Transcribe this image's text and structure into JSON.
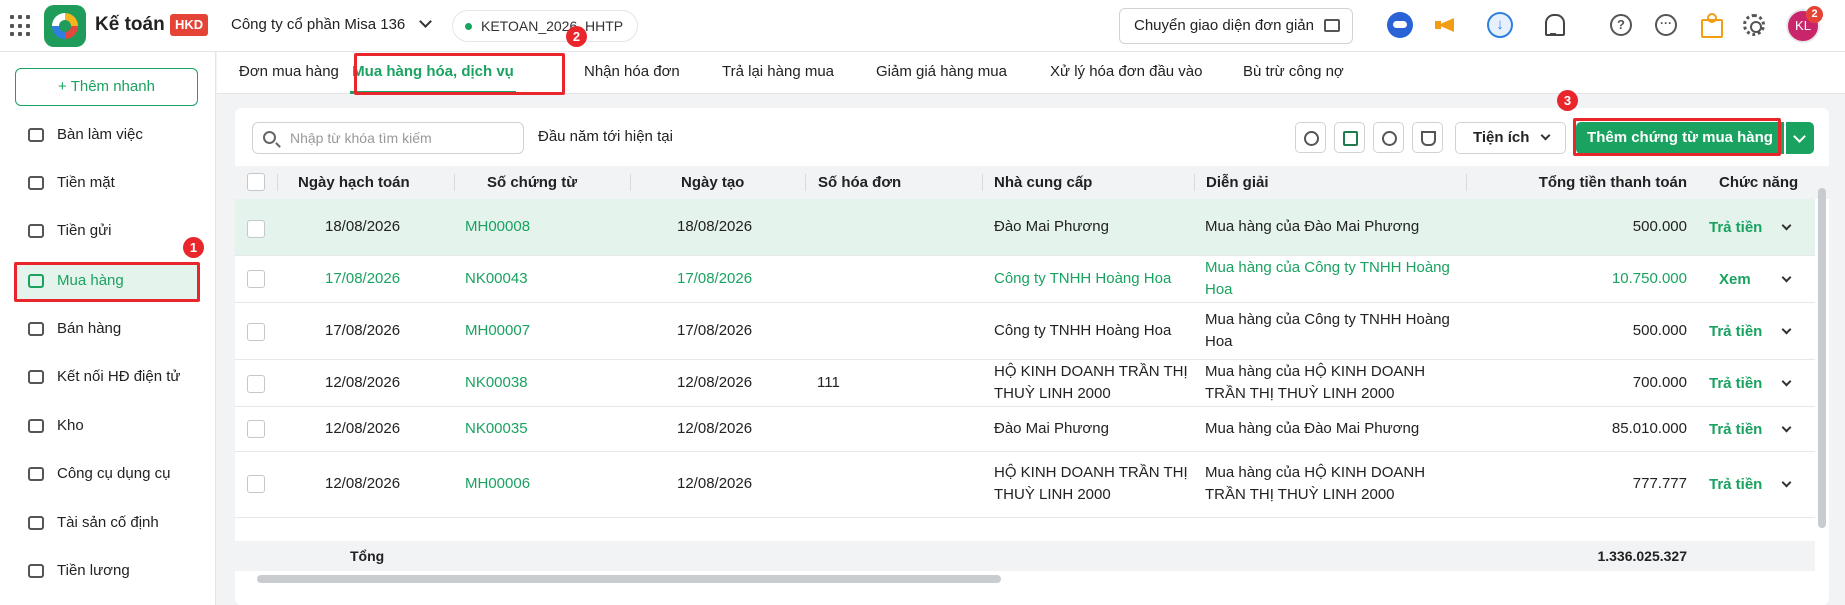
{
  "app": {
    "name": "Kế toán",
    "badge": "HKD"
  },
  "header": {
    "company": "Công ty cổ phần Misa 136",
    "database": "KETOAN_2026_HHTP",
    "switch_ui_label": "Chuyển giao diện đơn giản",
    "avatar_initials": "KL",
    "notification_count": "2"
  },
  "sidebar": {
    "quick_add": "+ Thêm nhanh",
    "items": [
      {
        "label": "Bàn làm việc",
        "icon": "dashboard-icon"
      },
      {
        "label": "Tiền mặt",
        "icon": "cash-icon"
      },
      {
        "label": "Tiền gửi",
        "icon": "bank-icon"
      },
      {
        "label": "Mua hàng",
        "icon": "cart-icon"
      },
      {
        "label": "Bán hàng",
        "icon": "tag-icon"
      },
      {
        "label": "Kết nối HĐ điện tử",
        "icon": "invoice-icon"
      },
      {
        "label": "Kho",
        "icon": "box-icon"
      },
      {
        "label": "Công cụ dụng cụ",
        "icon": "tools-icon"
      },
      {
        "label": "Tài sản cố định",
        "icon": "truck-icon"
      },
      {
        "label": "Tiền lương",
        "icon": "salary-icon"
      }
    ]
  },
  "annotations": {
    "step1": "1",
    "step2": "2",
    "step3": "3"
  },
  "tabs": [
    "Đơn mua hàng",
    "Mua hàng hóa, dịch vụ",
    "Nhận hóa đơn",
    "Trả lại hàng mua",
    "Giảm giá hàng mua",
    "Xử lý hóa đơn đầu vào",
    "Bù trừ công nợ"
  ],
  "toolbar": {
    "search_placeholder": "Nhập từ khóa tìm kiếm",
    "period": "Đầu năm tới hiện tại",
    "utilities": "Tiện ích",
    "add_voucher": "Thêm chứng từ mua hàng"
  },
  "table": {
    "columns": [
      "Ngày hạch toán",
      "Số chứng từ",
      "Ngày tạo",
      "Số hóa đơn",
      "Nhà cung cấp",
      "Diễn giải",
      "Tổng tiền thanh toán",
      "Chức năng"
    ],
    "rows": [
      {
        "posting_date": "18/08/2026",
        "voucher_no": "MH00008",
        "created_date": "18/08/2026",
        "invoice_no": "",
        "supplier": [
          "Đào Mai Phương"
        ],
        "description": [
          "Mua hàng của Đào Mai Phương"
        ],
        "total": "500.000",
        "action": "Trả tiền"
      },
      {
        "posting_date": "17/08/2026",
        "voucher_no": "NK00043",
        "created_date": "17/08/2026",
        "invoice_no": "",
        "supplier": [
          "Công ty TNHH Hoàng Hoa"
        ],
        "description": [
          "Mua hàng của Công ty TNHH Hoàng",
          "Hoa"
        ],
        "total": "10.750.000",
        "action": "Xem"
      },
      {
        "posting_date": "17/08/2026",
        "voucher_no": "MH00007",
        "created_date": "17/08/2026",
        "invoice_no": "",
        "supplier": [
          "Công ty TNHH Hoàng Hoa"
        ],
        "description": [
          "Mua hàng của Công ty TNHH Hoàng",
          "Hoa"
        ],
        "total": "500.000",
        "action": "Trả tiền"
      },
      {
        "posting_date": "12/08/2026",
        "voucher_no": "NK00038",
        "created_date": "12/08/2026",
        "invoice_no": "111",
        "supplier": [
          "HỘ KINH DOANH TRẦN THỊ",
          "THUỲ LINH 2000"
        ],
        "description": [
          "Mua hàng của HỘ KINH DOANH",
          "TRẦN THỊ THUỲ LINH 2000"
        ],
        "total": "700.000",
        "action": "Trả tiền"
      },
      {
        "posting_date": "12/08/2026",
        "voucher_no": "NK00035",
        "created_date": "12/08/2026",
        "invoice_no": "",
        "supplier": [
          "Đào Mai Phương"
        ],
        "description": [
          "Mua hàng của Đào Mai Phương"
        ],
        "total": "85.010.000",
        "action": "Trả tiền"
      },
      {
        "posting_date": "12/08/2026",
        "voucher_no": "MH00006",
        "created_date": "12/08/2026",
        "invoice_no": "",
        "supplier": [
          "HỘ KINH DOANH TRẦN THỊ",
          "THUỲ LINH 2000"
        ],
        "description": [
          "Mua hàng của HỘ KINH DOANH",
          "TRẦN THỊ THUỲ LINH 2000"
        ],
        "total": "777.777",
        "action": "Trả tiền"
      }
    ],
    "total_label": "Tổng",
    "total_value": "1.336.025.327"
  },
  "colors": {
    "accent": "#1aa260",
    "highlight": "#e8262b",
    "selected_row": "#e4f3ec"
  }
}
